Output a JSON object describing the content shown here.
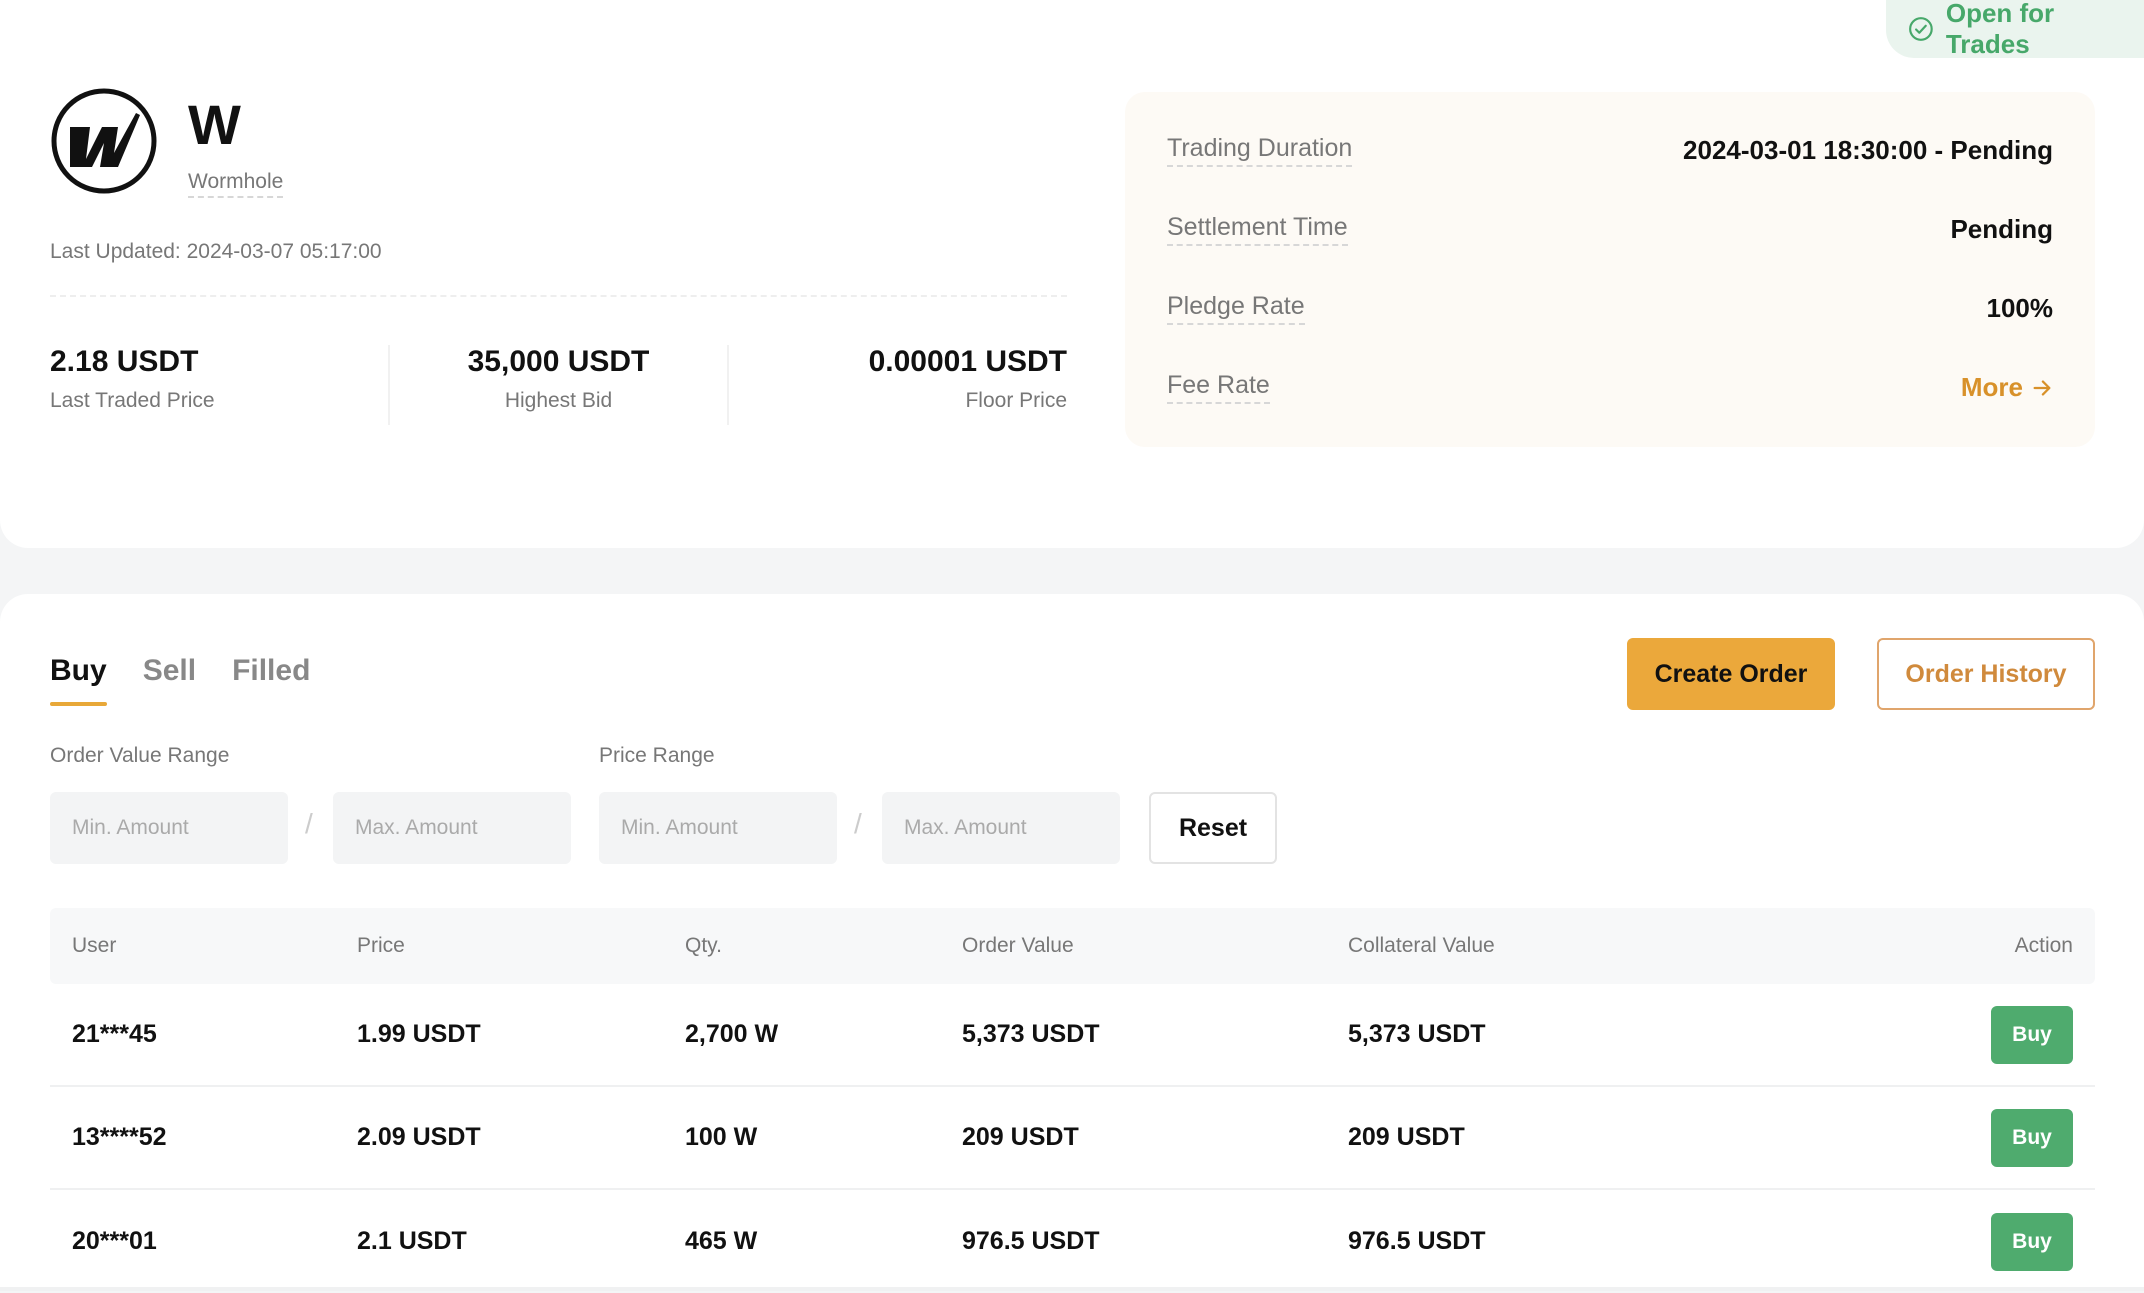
{
  "status": {
    "label": "Open for Trades",
    "icon": "check-circle-icon",
    "color": "#47a86a"
  },
  "token": {
    "symbol": "W",
    "name": "Wormhole",
    "logo_icon": "wormhole-logo-icon",
    "last_updated": "Last Updated: 2024-03-07 05:17:00"
  },
  "stats": [
    {
      "value": "2.18 USDT",
      "label": "Last Traded Price"
    },
    {
      "value": "35,000 USDT",
      "label": "Highest Bid"
    },
    {
      "value": "0.00001 USDT",
      "label": "Floor Price"
    }
  ],
  "info": {
    "trading_duration": {
      "label": "Trading Duration",
      "value": "2024-03-01 18:30:00 - Pending"
    },
    "settlement_time": {
      "label": "Settlement Time",
      "value": "Pending"
    },
    "pledge_rate": {
      "label": "Pledge Rate",
      "value": "100%"
    },
    "fee_rate": {
      "label": "Fee Rate",
      "link": "More",
      "link_icon": "arrow-right-icon"
    }
  },
  "tabs": [
    {
      "label": "Buy",
      "active": true
    },
    {
      "label": "Sell",
      "active": false
    },
    {
      "label": "Filled",
      "active": false
    }
  ],
  "actions": {
    "create_order": "Create Order",
    "order_history": "Order History",
    "reset": "Reset"
  },
  "filters": {
    "order_value_range": {
      "label": "Order Value Range",
      "min_placeholder": "Min. Amount",
      "max_placeholder": "Max. Amount",
      "min_value": "",
      "max_value": ""
    },
    "price_range": {
      "label": "Price Range",
      "min_placeholder": "Min. Amount",
      "max_placeholder": "Max. Amount",
      "min_value": "",
      "max_value": ""
    },
    "separator": "/"
  },
  "table": {
    "columns": [
      "User",
      "Price",
      "Qty.",
      "Order Value",
      "Collateral Value",
      "Action"
    ],
    "rows": [
      {
        "user": "21***45",
        "price": "1.99 USDT",
        "qty": "2,700 W",
        "order_value": "5,373 USDT",
        "collateral_value": "5,373 USDT",
        "action": "Buy"
      },
      {
        "user": "13****52",
        "price": "2.09 USDT",
        "qty": "100 W",
        "order_value": "209 USDT",
        "collateral_value": "209 USDT",
        "action": "Buy"
      },
      {
        "user": "20***01",
        "price": "2.1 USDT",
        "qty": "465 W",
        "order_value": "976.5 USDT",
        "collateral_value": "976.5 USDT",
        "action": "Buy"
      }
    ]
  },
  "colors": {
    "accent": "#eba83b",
    "accent_text": "#d8912a",
    "buy_green": "#4fab6e",
    "info_panel_bg": "#fdfaf5"
  }
}
